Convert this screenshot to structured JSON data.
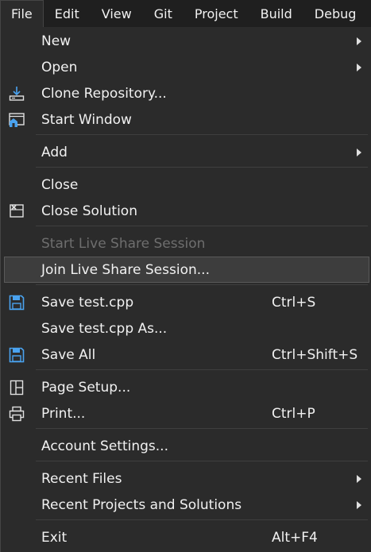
{
  "menubar": {
    "items": [
      "File",
      "Edit",
      "View",
      "Git",
      "Project",
      "Build",
      "Debug"
    ]
  },
  "file_menu": {
    "new": "New",
    "open": "Open",
    "clone_repository": "Clone Repository...",
    "start_window": "Start Window",
    "add": "Add",
    "close": "Close",
    "close_solution": "Close Solution",
    "start_live_share": "Start Live Share Session",
    "join_live_share": "Join Live Share Session...",
    "save_file": "Save test.cpp",
    "save_file_shortcut": "Ctrl+S",
    "save_file_as": "Save test.cpp As...",
    "save_all": "Save All",
    "save_all_shortcut": "Ctrl+Shift+S",
    "page_setup": "Page Setup...",
    "print": "Print...",
    "print_shortcut": "Ctrl+P",
    "account_settings": "Account Settings...",
    "recent_files": "Recent Files",
    "recent_projects": "Recent Projects and Solutions",
    "exit": "Exit",
    "exit_shortcut": "Alt+F4"
  },
  "colors": {
    "accent_icon": "#4aa3f0",
    "menu_background": "#2b2b2b",
    "highlight_background": "#3d3d3d"
  }
}
